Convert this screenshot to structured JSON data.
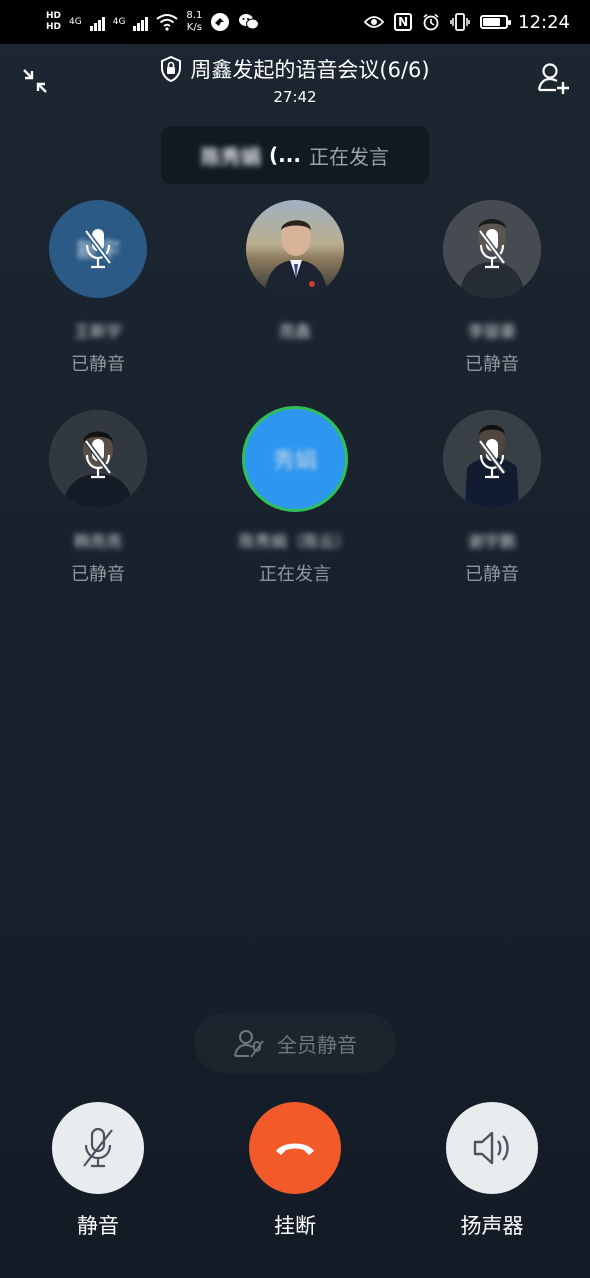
{
  "status_bar": {
    "hd_top": "HD",
    "hd_bottom": "HD",
    "net1": "4G",
    "net2": "4G",
    "speed_value": "8.1",
    "speed_unit": "K/s",
    "nfc": "N",
    "time": "12:24",
    "battery_level": 0.8
  },
  "header": {
    "title": "周鑫发起的语音会议(6/6)",
    "timer": "27:42"
  },
  "speaking_banner": {
    "name": "陈秀娟",
    "suffix": "(...",
    "status": "正在发言"
  },
  "participants": [
    {
      "name": "王新宇",
      "initials": "新宇",
      "status": "已静音",
      "muted": true,
      "avatar_color": "#2b5a86"
    },
    {
      "name": "周鑫",
      "status": "",
      "muted": false,
      "avatar_color": "#6b7b8a"
    },
    {
      "name": "李骏豪",
      "status": "已静音",
      "muted": true,
      "avatar_color": "#56616c"
    },
    {
      "name": "韩亮亮",
      "status": "已静音",
      "muted": true,
      "avatar_color": "#3f4b57"
    },
    {
      "name": "陈秀娟（陈云）",
      "initials": "秀娟",
      "status": "正在发言",
      "muted": false,
      "avatar_color": "#2d97ef",
      "speaking_ring": "#2fbf5a"
    },
    {
      "name": "谢宇鹏",
      "status": "已静音",
      "muted": true,
      "avatar_color": "#4a5661"
    }
  ],
  "mute_all": {
    "label": "全员静音"
  },
  "controls": {
    "mute_label": "静音",
    "hangup_label": "挂断",
    "speaker_label": "扬声器",
    "hangup_color": "#f25a2a"
  },
  "icons": {
    "shrink": "shrink-icon",
    "add_member": "add-member-icon",
    "lock": "lock-shield-icon",
    "mic_off": "mic-off-icon",
    "phone": "phone-hangup-icon",
    "speaker": "speaker-icon"
  }
}
